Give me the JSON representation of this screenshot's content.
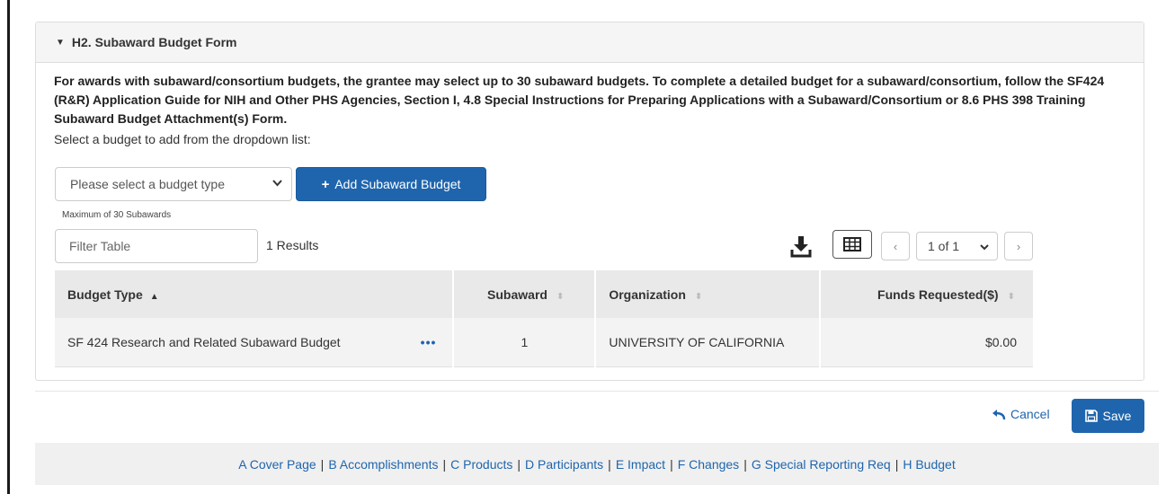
{
  "section": {
    "title": "H2. Subaward Budget Form",
    "instructions": "For awards with subaward/consortium budgets, the grantee may select up to 30 subaward budgets. To complete a detailed budget for a subaward/consortium, follow the SF424 (R&R) Application Guide for NIH and Other PHS Agencies, Section I, 4.8 Special Instructions for Preparing Applications with a Subaward/Consortium or 8.6 PHS 398 Training Subaward Budget Attachment(s) Form.",
    "select_label": "Select a budget to add from the dropdown list:",
    "budget_select_value": "Please select a budget type",
    "add_button_label": "Add Subaward Budget",
    "max_note": "Maximum of 30 Subawards"
  },
  "table_controls": {
    "filter_placeholder": "Filter Table",
    "results": "1 Results",
    "page_value": "1 of 1"
  },
  "table": {
    "columns": [
      "Budget Type",
      "Subaward",
      "Organization",
      "Funds Requested($)"
    ],
    "rows": [
      [
        "SF 424 Research and Related Subaward Budget",
        "1",
        "UNIVERSITY OF CALIFORNIA",
        "$0.00"
      ]
    ]
  },
  "actions": {
    "cancel_label": "Cancel",
    "save_label": "Save"
  },
  "footer_nav": [
    "A Cover Page",
    "B Accomplishments",
    "C Products",
    "D Participants",
    "E Impact",
    "F Changes",
    "G Special Reporting Req",
    "H Budget"
  ],
  "colors": {
    "primary": "#1f65ad",
    "header_bg": "#f5f5f5",
    "table_header_bg": "#e9e9e9"
  }
}
